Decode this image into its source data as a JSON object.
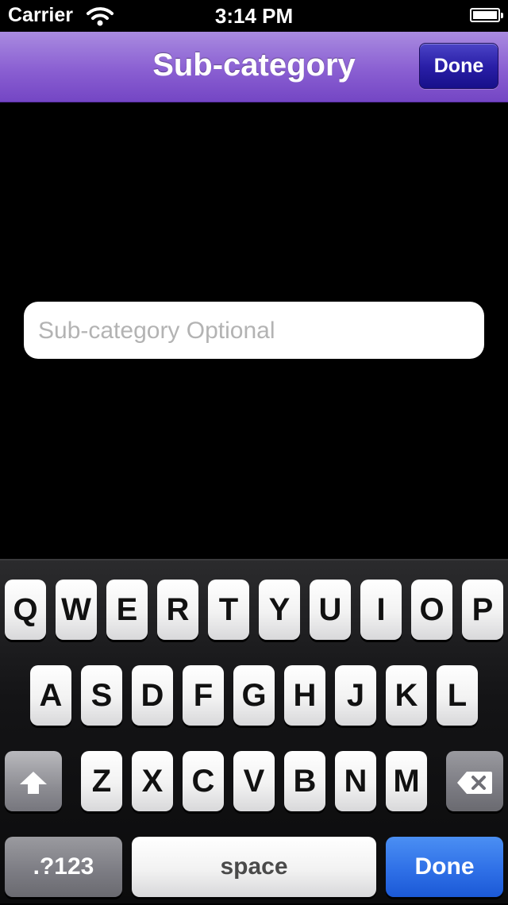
{
  "status_bar": {
    "carrier": "Carrier",
    "time": "3:14 PM"
  },
  "navbar": {
    "title": "Sub-category",
    "done_label": "Done"
  },
  "field": {
    "placeholder": "Sub-category Optional",
    "value": ""
  },
  "keyboard": {
    "row1": [
      "Q",
      "W",
      "E",
      "R",
      "T",
      "Y",
      "U",
      "I",
      "O",
      "P"
    ],
    "row2": [
      "A",
      "S",
      "D",
      "F",
      "G",
      "H",
      "J",
      "K",
      "L"
    ],
    "row3": [
      "Z",
      "X",
      "C",
      "V",
      "B",
      "N",
      "M"
    ],
    "numbers_label": ".?123",
    "space_label": "space",
    "done_label": "Done"
  },
  "colors": {
    "navbar_purple": "#8a5fd2",
    "done_blue": "#2f70e7"
  },
  "icons": {
    "wifi": "wifi-icon",
    "battery": "battery-icon",
    "shift": "shift-icon",
    "delete": "delete-icon"
  }
}
